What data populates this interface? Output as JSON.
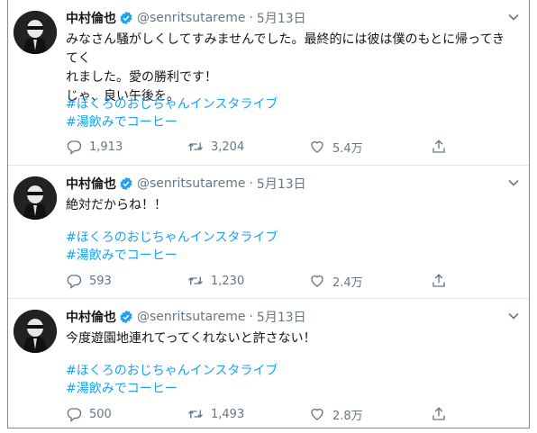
{
  "tweets": [
    {
      "name": "中村倫也",
      "handle": "@senritsutareme",
      "date": "5月13日",
      "text_lines": [
        "みなさん騒がしくしてすみませんでした。最終的には彼は僕のもとに帰ってきてく",
        "れました。愛の勝利です！",
        "じゃ、良い午後を。"
      ],
      "hashtags": [
        "#ほくろのおじちゃんインスタライブ",
        "#湯飲みでコーヒー"
      ],
      "replies": "1,913",
      "retweets": "3,204",
      "likes": "5.4万"
    },
    {
      "name": "中村倫也",
      "handle": "@senritsutareme",
      "date": "5月13日",
      "text_lines": [
        "絶対だからね！！"
      ],
      "hashtags": [
        "#ほくろのおじちゃんインスタライブ",
        "#湯飲みでコーヒー"
      ],
      "replies": "593",
      "retweets": "1,230",
      "likes": "2.4万"
    },
    {
      "name": "中村倫也",
      "handle": "@senritsutareme",
      "date": "5月13日",
      "text_lines": [
        "今度遊園地連れてってくれないと許さない！"
      ],
      "hashtags": [
        "#ほくろのおじちゃんインスタライブ",
        "#湯飲みでコーヒー"
      ],
      "replies": "500",
      "retweets": "1,493",
      "likes": "2.8万"
    }
  ],
  "colors": {
    "link": "#1da1f2",
    "muted": "#657786",
    "verified": "#1da1f2"
  },
  "icons": [
    "reply-icon",
    "retweet-icon",
    "like-icon",
    "share-icon",
    "verified-icon",
    "chevron-down-icon"
  ]
}
